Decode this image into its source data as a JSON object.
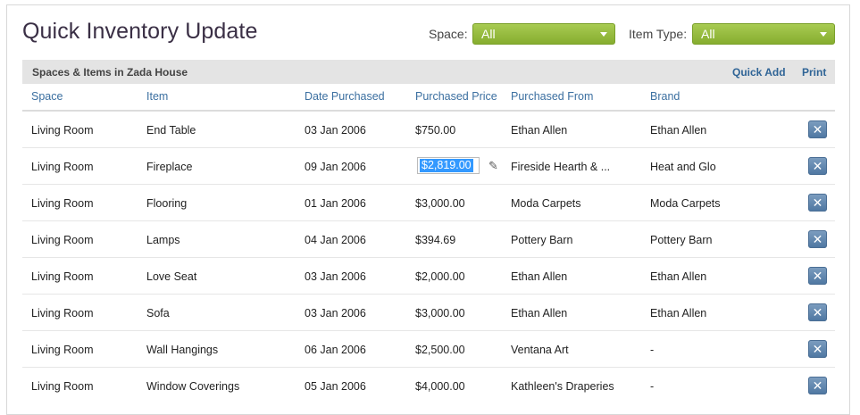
{
  "page": {
    "title": "Quick Inventory Update"
  },
  "filters": {
    "space_label": "Space:",
    "space_value": "All",
    "item_type_label": "Item Type:",
    "item_type_value": "All"
  },
  "section": {
    "title": "Spaces & Items in Zada House",
    "quick_add": "Quick Add",
    "print": "Print"
  },
  "columns": [
    "Space",
    "Item",
    "Date Purchased",
    "Purchased Price",
    "Purchased From",
    "Brand"
  ],
  "rows": [
    {
      "space": "Living Room",
      "item": "End Table",
      "date": "03 Jan 2006",
      "price": "$750.00",
      "from": "Ethan Allen",
      "brand": "Ethan Allen"
    },
    {
      "space": "Living Room",
      "item": "Fireplace",
      "date": "09 Jan 2006",
      "price": "$2,819.00",
      "from": "Fireside Hearth & ...",
      "brand": "Heat and Glo",
      "editing": true
    },
    {
      "space": "Living Room",
      "item": "Flooring",
      "date": "01 Jan 2006",
      "price": "$3,000.00",
      "from": "Moda Carpets",
      "brand": "Moda Carpets"
    },
    {
      "space": "Living Room",
      "item": "Lamps",
      "date": "04 Jan 2006",
      "price": "$394.69",
      "from": "Pottery Barn",
      "brand": "Pottery Barn"
    },
    {
      "space": "Living Room",
      "item": "Love Seat",
      "date": "03 Jan 2006",
      "price": "$2,000.00",
      "from": "Ethan Allen",
      "brand": "Ethan Allen"
    },
    {
      "space": "Living Room",
      "item": "Sofa",
      "date": "03 Jan 2006",
      "price": "$3,000.00",
      "from": "Ethan Allen",
      "brand": "Ethan Allen"
    },
    {
      "space": "Living Room",
      "item": "Wall Hangings",
      "date": "06 Jan 2006",
      "price": "$2,500.00",
      "from": "Ventana Art",
      "brand": "-"
    },
    {
      "space": "Living Room",
      "item": "Window Coverings",
      "date": "05 Jan 2006",
      "price": "$4,000.00",
      "from": "Kathleen's Draperies",
      "brand": "-"
    }
  ],
  "icons": {
    "delete": "close-icon",
    "edit": "pencil-icon",
    "dropdown": "chevron-down-icon"
  },
  "colors": {
    "accent_green": "#8ab534",
    "link_blue": "#2f6496",
    "delete_blue": "#5b82ad"
  }
}
